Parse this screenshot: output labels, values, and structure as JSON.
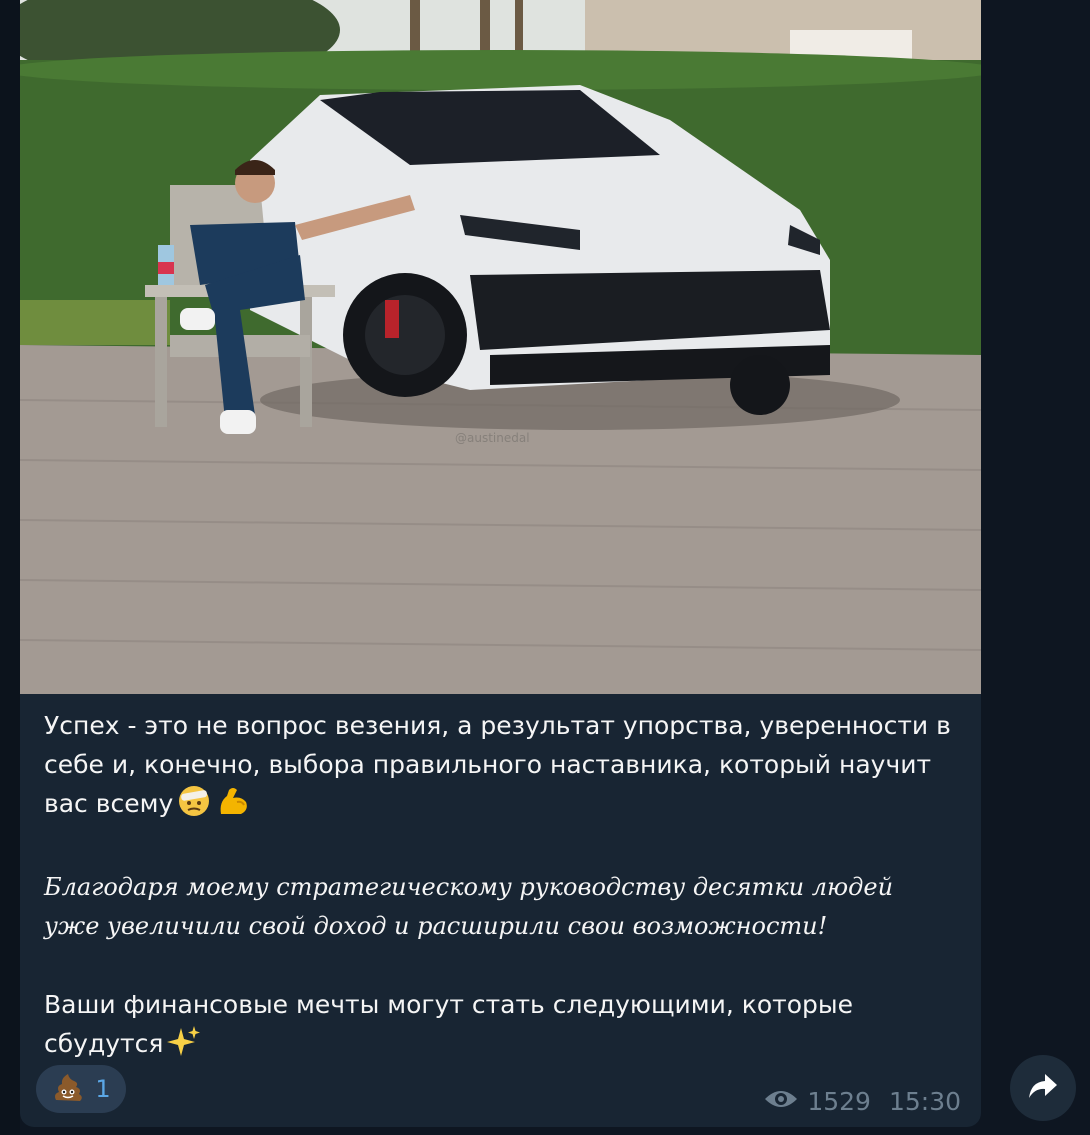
{
  "post": {
    "photo_alt": "",
    "watermark": "@austinedal",
    "paragraph1": "Успех - это не вопрос везения, а результат упорства, уверенности в себе и, конечно, выбора правильного наставника, который научит вас всему",
    "paragraph1_emojis": [
      "bandaged-face-emoji",
      "flexed-biceps-emoji"
    ],
    "paragraph2": "Благодаря моему стратегическому руководству десятки людей уже увеличили свой доход и расширили свои возможности!",
    "paragraph3": "Ваши финансовые мечты могут стать следующими, которые сбудутся",
    "paragraph3_emoji": "sparkles-emoji"
  },
  "reaction": {
    "icon": "pile-of-poo-emoji",
    "count": "1"
  },
  "meta": {
    "views": "1529",
    "time": "15:30"
  },
  "colors": {
    "background": "#0e1621",
    "bubble": "#182533",
    "text": "#f5f5f5",
    "meta": "#6d7f8f",
    "reaction_count": "#5ba7e6"
  }
}
